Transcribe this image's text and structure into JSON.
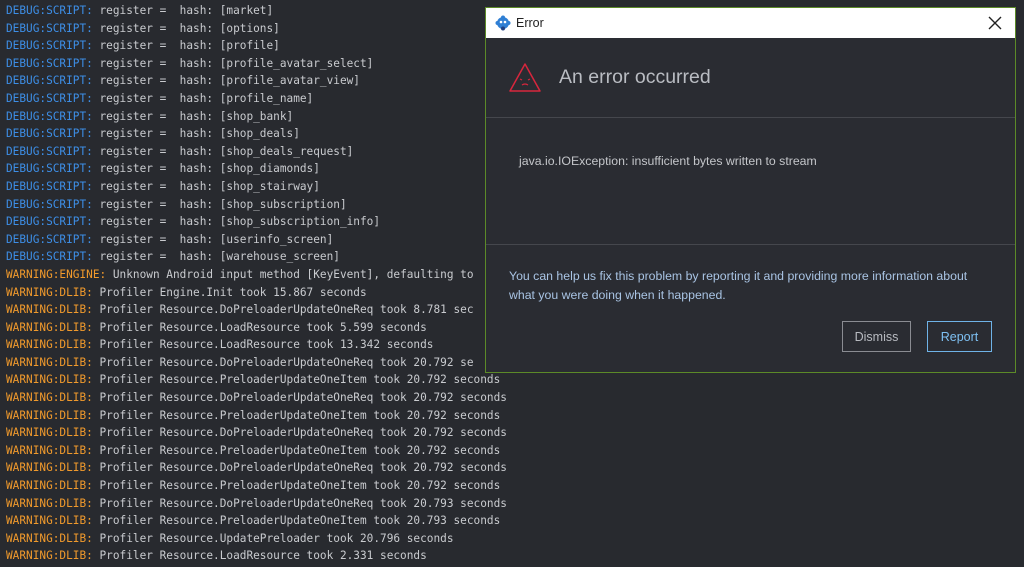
{
  "console": {
    "lines": [
      {
        "level": "debug",
        "prefix": "DEBUG:SCRIPT:",
        "text": " register =  hash: [market]"
      },
      {
        "level": "debug",
        "prefix": "DEBUG:SCRIPT:",
        "text": " register =  hash: [options]"
      },
      {
        "level": "debug",
        "prefix": "DEBUG:SCRIPT:",
        "text": " register =  hash: [profile]"
      },
      {
        "level": "debug",
        "prefix": "DEBUG:SCRIPT:",
        "text": " register =  hash: [profile_avatar_select]"
      },
      {
        "level": "debug",
        "prefix": "DEBUG:SCRIPT:",
        "text": " register =  hash: [profile_avatar_view]"
      },
      {
        "level": "debug",
        "prefix": "DEBUG:SCRIPT:",
        "text": " register =  hash: [profile_name]"
      },
      {
        "level": "debug",
        "prefix": "DEBUG:SCRIPT:",
        "text": " register =  hash: [shop_bank]"
      },
      {
        "level": "debug",
        "prefix": "DEBUG:SCRIPT:",
        "text": " register =  hash: [shop_deals]"
      },
      {
        "level": "debug",
        "prefix": "DEBUG:SCRIPT:",
        "text": " register =  hash: [shop_deals_request]"
      },
      {
        "level": "debug",
        "prefix": "DEBUG:SCRIPT:",
        "text": " register =  hash: [shop_diamonds]"
      },
      {
        "level": "debug",
        "prefix": "DEBUG:SCRIPT:",
        "text": " register =  hash: [shop_stairway]"
      },
      {
        "level": "debug",
        "prefix": "DEBUG:SCRIPT:",
        "text": " register =  hash: [shop_subscription]"
      },
      {
        "level": "debug",
        "prefix": "DEBUG:SCRIPT:",
        "text": " register =  hash: [shop_subscription_info]"
      },
      {
        "level": "debug",
        "prefix": "DEBUG:SCRIPT:",
        "text": " register =  hash: [userinfo_screen]"
      },
      {
        "level": "debug",
        "prefix": "DEBUG:SCRIPT:",
        "text": " register =  hash: [warehouse_screen]"
      },
      {
        "level": "warning",
        "prefix": "WARNING:ENGINE:",
        "text": " Unknown Android input method [KeyEvent], defaulting to"
      },
      {
        "level": "warning",
        "prefix": "WARNING:DLIB:",
        "text": " Profiler Engine.Init took 15.867 seconds"
      },
      {
        "level": "warning",
        "prefix": "WARNING:DLIB:",
        "text": " Profiler Resource.DoPreloaderUpdateOneReq took 8.781 sec"
      },
      {
        "level": "warning",
        "prefix": "WARNING:DLIB:",
        "text": " Profiler Resource.LoadResource took 5.599 seconds"
      },
      {
        "level": "warning",
        "prefix": "WARNING:DLIB:",
        "text": " Profiler Resource.LoadResource took 13.342 seconds"
      },
      {
        "level": "warning",
        "prefix": "WARNING:DLIB:",
        "text": " Profiler Resource.DoPreloaderUpdateOneReq took 20.792 se"
      },
      {
        "level": "warning",
        "prefix": "WARNING:DLIB:",
        "text": " Profiler Resource.PreloaderUpdateOneItem took 20.792 seconds"
      },
      {
        "level": "warning",
        "prefix": "WARNING:DLIB:",
        "text": " Profiler Resource.DoPreloaderUpdateOneReq took 20.792 seconds"
      },
      {
        "level": "warning",
        "prefix": "WARNING:DLIB:",
        "text": " Profiler Resource.PreloaderUpdateOneItem took 20.792 seconds"
      },
      {
        "level": "warning",
        "prefix": "WARNING:DLIB:",
        "text": " Profiler Resource.DoPreloaderUpdateOneReq took 20.792 seconds"
      },
      {
        "level": "warning",
        "prefix": "WARNING:DLIB:",
        "text": " Profiler Resource.PreloaderUpdateOneItem took 20.792 seconds"
      },
      {
        "level": "warning",
        "prefix": "WARNING:DLIB:",
        "text": " Profiler Resource.DoPreloaderUpdateOneReq took 20.792 seconds"
      },
      {
        "level": "warning",
        "prefix": "WARNING:DLIB:",
        "text": " Profiler Resource.PreloaderUpdateOneItem took 20.792 seconds"
      },
      {
        "level": "warning",
        "prefix": "WARNING:DLIB:",
        "text": " Profiler Resource.DoPreloaderUpdateOneReq took 20.793 seconds"
      },
      {
        "level": "warning",
        "prefix": "WARNING:DLIB:",
        "text": " Profiler Resource.PreloaderUpdateOneItem took 20.793 seconds"
      },
      {
        "level": "warning",
        "prefix": "WARNING:DLIB:",
        "text": " Profiler Resource.UpdatePreloader took 20.796 seconds"
      },
      {
        "level": "warning",
        "prefix": "WARNING:DLIB:",
        "text": " Profiler Resource.LoadResource took 2.331 seconds"
      }
    ]
  },
  "dialog": {
    "title": "Error",
    "app_icon": "defold-logo-icon",
    "heading": "An error occurred",
    "heading_icon": "sad-warning-triangle-icon",
    "message": "java.io.IOException: insufficient bytes written to stream",
    "help_text": "You can help us fix this problem by reporting it and providing more information about what you were doing when it happened.",
    "dismiss_label": "Dismiss",
    "report_label": "Report",
    "colors": {
      "accent": "#7ec0f2",
      "error": "#d7263d",
      "border": "#5c8a28"
    }
  }
}
